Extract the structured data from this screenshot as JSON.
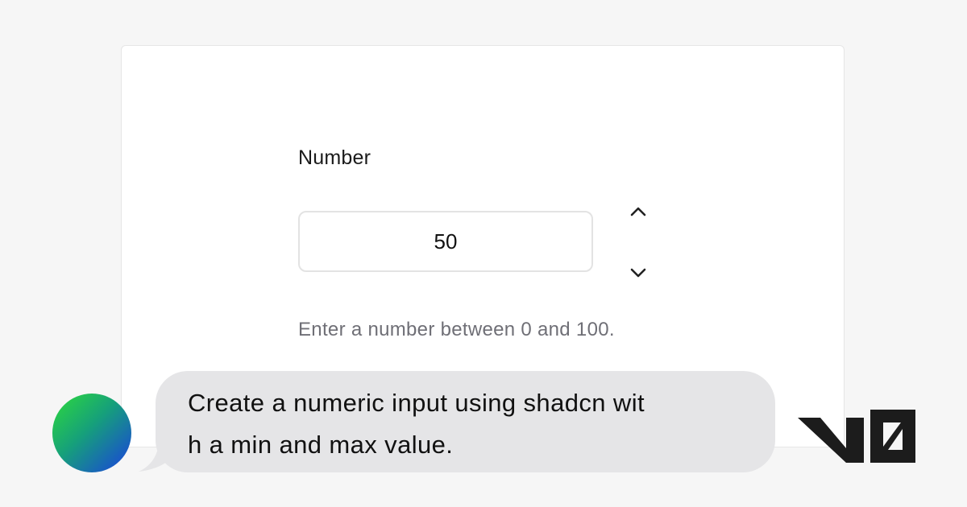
{
  "form": {
    "label": "Number",
    "value": "50",
    "helper_text": "Enter a number between 0 and 100.",
    "increment_icon": "chevron-up-icon",
    "decrement_icon": "chevron-down-icon"
  },
  "chat": {
    "message_lines": [
      "Create a numeric input using shadcn wit",
      "h a min and max value."
    ],
    "avatar_colors": [
      "#2edb3a",
      "#1a3fe0"
    ],
    "bubble_color": "#e5e5e7"
  },
  "brand": {
    "logo": "v0-logo"
  }
}
